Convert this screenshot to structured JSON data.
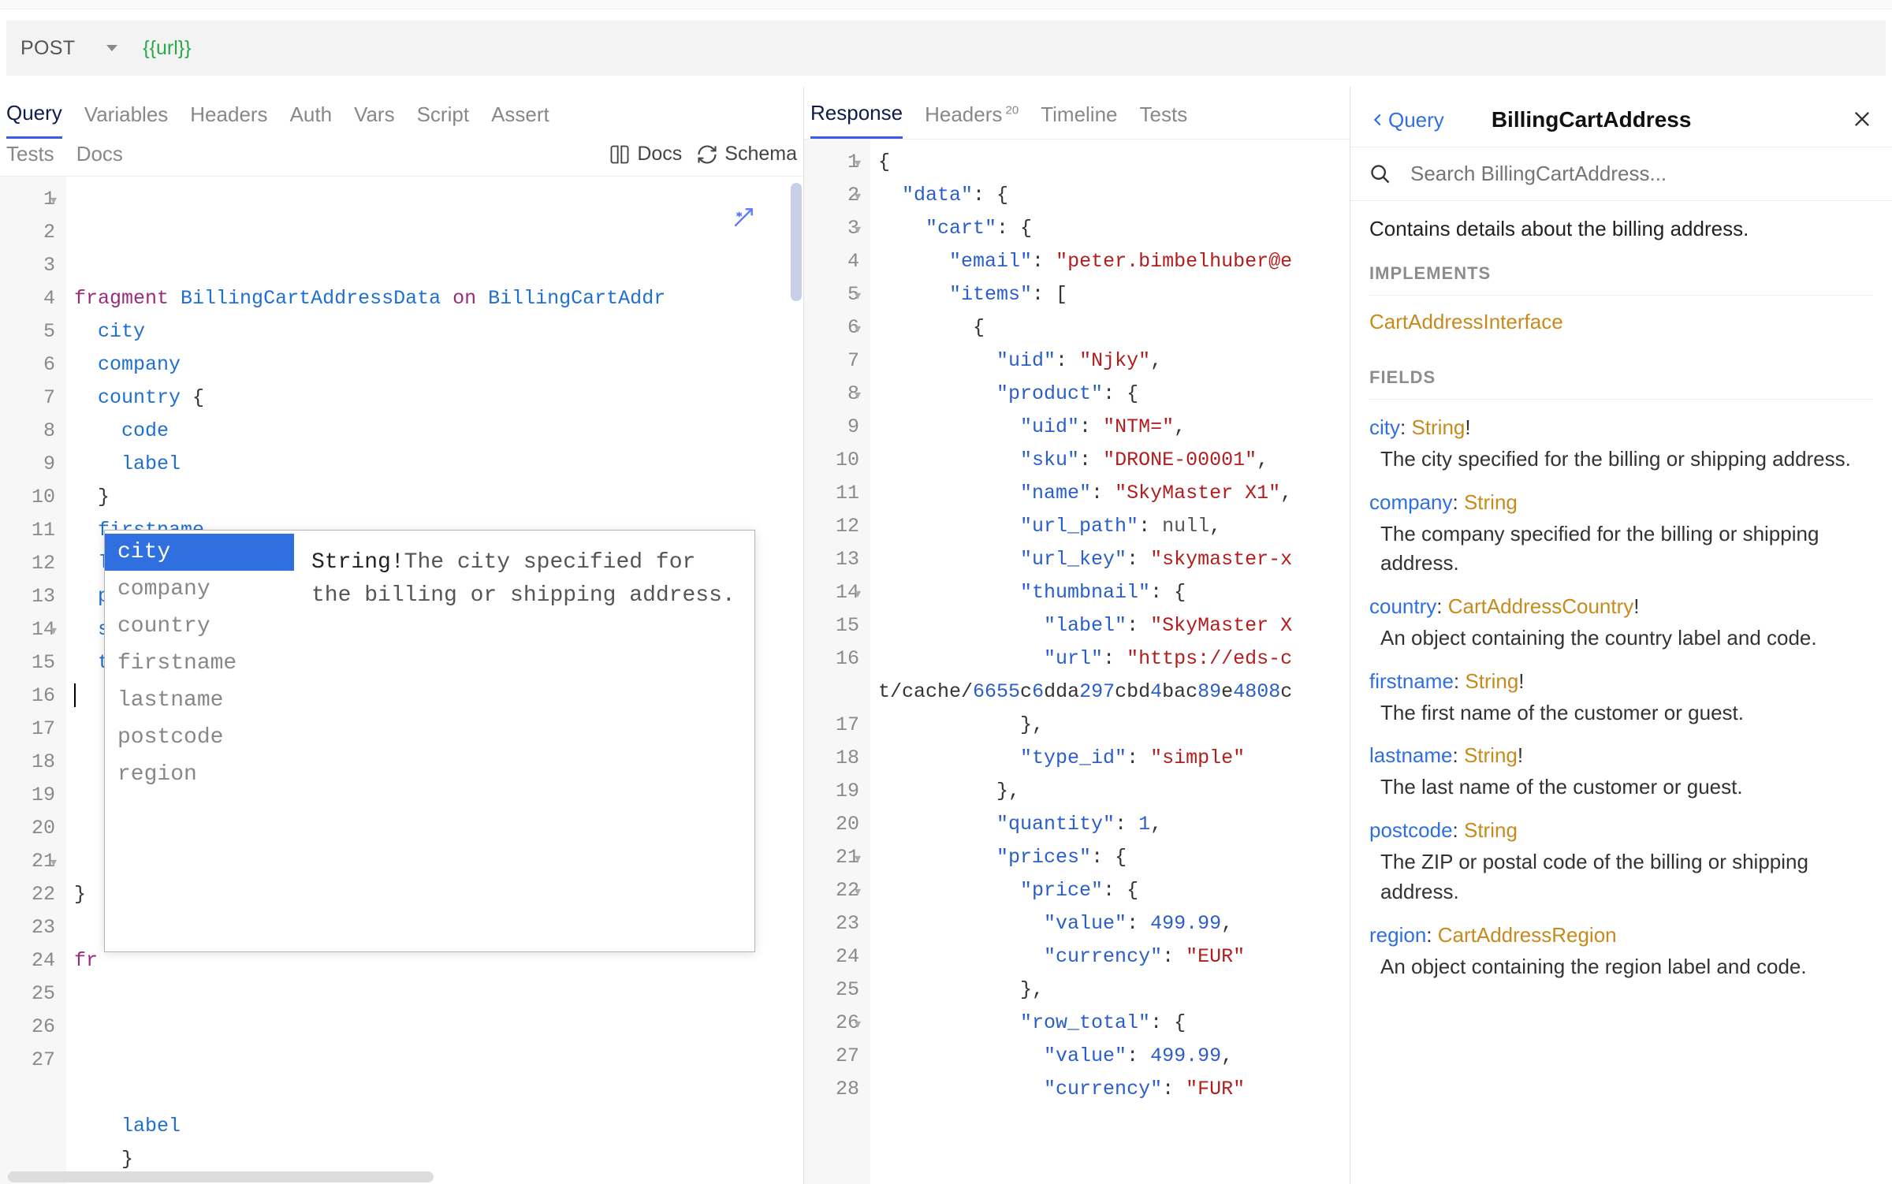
{
  "request": {
    "method": "POST",
    "url_template": "{{url}}"
  },
  "left_tabs": {
    "row1": [
      "Query",
      "Variables",
      "Headers",
      "Auth",
      "Vars",
      "Script",
      "Assert"
    ],
    "row2": [
      "Tests",
      "Docs"
    ],
    "active": "Query",
    "tools": {
      "docs": "Docs",
      "schema": "Schema"
    }
  },
  "query_editor": {
    "lines": [
      {
        "n": 1,
        "fold": true,
        "tokens": [
          [
            "kw",
            "fragment"
          ],
          [
            "sp",
            " "
          ],
          [
            "type",
            "BillingCartAddressData"
          ],
          [
            "sp",
            " "
          ],
          [
            "kw",
            "on"
          ],
          [
            "sp",
            " "
          ],
          [
            "type",
            "BillingCartAddr"
          ]
        ]
      },
      {
        "n": 2,
        "tokens": [
          [
            "sp",
            "  "
          ],
          [
            "field",
            "city"
          ]
        ]
      },
      {
        "n": 3,
        "tokens": [
          [
            "sp",
            "  "
          ],
          [
            "field",
            "company"
          ]
        ]
      },
      {
        "n": 4,
        "tokens": [
          [
            "sp",
            "  "
          ],
          [
            "field",
            "country"
          ],
          [
            "plain",
            " {"
          ]
        ]
      },
      {
        "n": 5,
        "tokens": [
          [
            "sp",
            "    "
          ],
          [
            "field",
            "code"
          ]
        ]
      },
      {
        "n": 6,
        "tokens": [
          [
            "sp",
            "    "
          ],
          [
            "field",
            "label"
          ]
        ]
      },
      {
        "n": 7,
        "tokens": [
          [
            "sp",
            "  "
          ],
          [
            "plain",
            "}"
          ]
        ]
      },
      {
        "n": 8,
        "tokens": [
          [
            "sp",
            "  "
          ],
          [
            "field",
            "firstname"
          ]
        ]
      },
      {
        "n": 9,
        "tokens": [
          [
            "sp",
            "  "
          ],
          [
            "field",
            "lastname"
          ]
        ]
      },
      {
        "n": 10,
        "tokens": [
          [
            "sp",
            "  "
          ],
          [
            "field",
            "postcode"
          ]
        ]
      },
      {
        "n": 11,
        "tokens": [
          [
            "sp",
            "  "
          ],
          [
            "field",
            "street"
          ]
        ]
      },
      {
        "n": 12,
        "tokens": [
          [
            "sp",
            "  "
          ],
          [
            "field",
            "telephone"
          ]
        ]
      },
      {
        "n": 13,
        "tokens": [
          [
            "cursor",
            ""
          ]
        ]
      },
      {
        "n": 14,
        "fold": true,
        "tokens": []
      },
      {
        "n": 15,
        "tokens": []
      },
      {
        "n": 16,
        "tokens": []
      },
      {
        "n": 17,
        "tokens": []
      },
      {
        "n": 18,
        "tokens": []
      },
      {
        "n": 19,
        "tokens": [
          [
            "plain",
            "}"
          ]
        ]
      },
      {
        "n": 20,
        "tokens": []
      },
      {
        "n": 21,
        "fold": true,
        "tokens": [
          [
            "kw",
            "fr"
          ]
        ]
      },
      {
        "n": 22,
        "tokens": []
      },
      {
        "n": 23,
        "tokens": []
      },
      {
        "n": 24,
        "tokens": []
      },
      {
        "n": 25,
        "tokens": []
      },
      {
        "n": 26,
        "tokens": [
          [
            "sp",
            "    "
          ],
          [
            "field",
            "label"
          ]
        ]
      },
      {
        "n": 27,
        "tokens": [
          [
            "sp",
            "    "
          ],
          [
            "plain",
            "}"
          ]
        ]
      }
    ]
  },
  "autocomplete": {
    "items": [
      "city",
      "company",
      "country",
      "firstname",
      "lastname",
      "postcode",
      "region"
    ],
    "selected": "city",
    "detail": {
      "type": "String",
      "required": true,
      "desc": "The city specified for the billing or shipping address."
    }
  },
  "mid_tabs": {
    "items": [
      {
        "label": "Response",
        "active": true
      },
      {
        "label": "Headers",
        "badge": "20"
      },
      {
        "label": "Timeline"
      },
      {
        "label": "Tests"
      }
    ]
  },
  "response_editor": {
    "lines": [
      {
        "n": 1,
        "fold": true,
        "txt": "{"
      },
      {
        "n": 2,
        "fold": true,
        "txt": "  \"data\": {"
      },
      {
        "n": 3,
        "fold": true,
        "txt": "    \"cart\": {"
      },
      {
        "n": 4,
        "txt": "      \"email\": \"peter.bimbelhuber@e"
      },
      {
        "n": 5,
        "fold": true,
        "txt": "      \"items\": ["
      },
      {
        "n": 6,
        "fold": true,
        "txt": "        {"
      },
      {
        "n": 7,
        "txt": "          \"uid\": \"Njky\","
      },
      {
        "n": 8,
        "fold": true,
        "txt": "          \"product\": {"
      },
      {
        "n": 9,
        "txt": "            \"uid\": \"NTM=\","
      },
      {
        "n": 10,
        "txt": "            \"sku\": \"DRONE-00001\","
      },
      {
        "n": 11,
        "txt": "            \"name\": \"SkyMaster X1\","
      },
      {
        "n": 12,
        "txt": "            \"url_path\": null,"
      },
      {
        "n": 13,
        "txt": "            \"url_key\": \"skymaster-x"
      },
      {
        "n": 14,
        "fold": true,
        "txt": "            \"thumbnail\": {"
      },
      {
        "n": 15,
        "txt": "              \"label\": \"SkyMaster X"
      },
      {
        "n": 16,
        "txt": "              \"url\": \"https://eds-c"
      },
      {
        "n": 16.5,
        "txt": "t/cache/6655c6dda297cbd4bac89e4808c"
      },
      {
        "n": 17,
        "txt": "            },"
      },
      {
        "n": 18,
        "txt": "            \"type_id\": \"simple\""
      },
      {
        "n": 19,
        "txt": "          },"
      },
      {
        "n": 20,
        "txt": "          \"quantity\": 1,"
      },
      {
        "n": 21,
        "fold": true,
        "txt": "          \"prices\": {"
      },
      {
        "n": 22,
        "fold": true,
        "txt": "            \"price\": {"
      },
      {
        "n": 23,
        "txt": "              \"value\": 499.99,"
      },
      {
        "n": 24,
        "txt": "              \"currency\": \"EUR\""
      },
      {
        "n": 25,
        "txt": "            },"
      },
      {
        "n": 26,
        "fold": true,
        "txt": "            \"row_total\": {"
      },
      {
        "n": 27,
        "txt": "              \"value\": 499.99,"
      },
      {
        "n": 28,
        "txt": "              \"currency\": \"FUR\""
      }
    ]
  },
  "docs": {
    "back_label": "Query",
    "title": "BillingCartAddress",
    "search_placeholder": "Search BillingCartAddress...",
    "description": "Contains details about the billing address.",
    "implements_header": "IMPLEMENTS",
    "implements": [
      "CartAddressInterface"
    ],
    "fields_header": "FIELDS",
    "fields": [
      {
        "name": "city",
        "type": "String",
        "required": true,
        "desc": "The city specified for the billing or shipping address."
      },
      {
        "name": "company",
        "type": "String",
        "required": false,
        "desc": "The company specified for the billing or shipping address."
      },
      {
        "name": "country",
        "type": "CartAddressCountry",
        "required": true,
        "desc": "An object containing the country label and code."
      },
      {
        "name": "firstname",
        "type": "String",
        "required": true,
        "desc": "The first name of the customer or guest."
      },
      {
        "name": "lastname",
        "type": "String",
        "required": true,
        "desc": "The last name of the customer or guest."
      },
      {
        "name": "postcode",
        "type": "String",
        "required": false,
        "desc": "The ZIP or postal code of the billing or shipping address."
      },
      {
        "name": "region",
        "type": "CartAddressRegion",
        "required": false,
        "desc": "An object containing the region label and code."
      }
    ]
  }
}
